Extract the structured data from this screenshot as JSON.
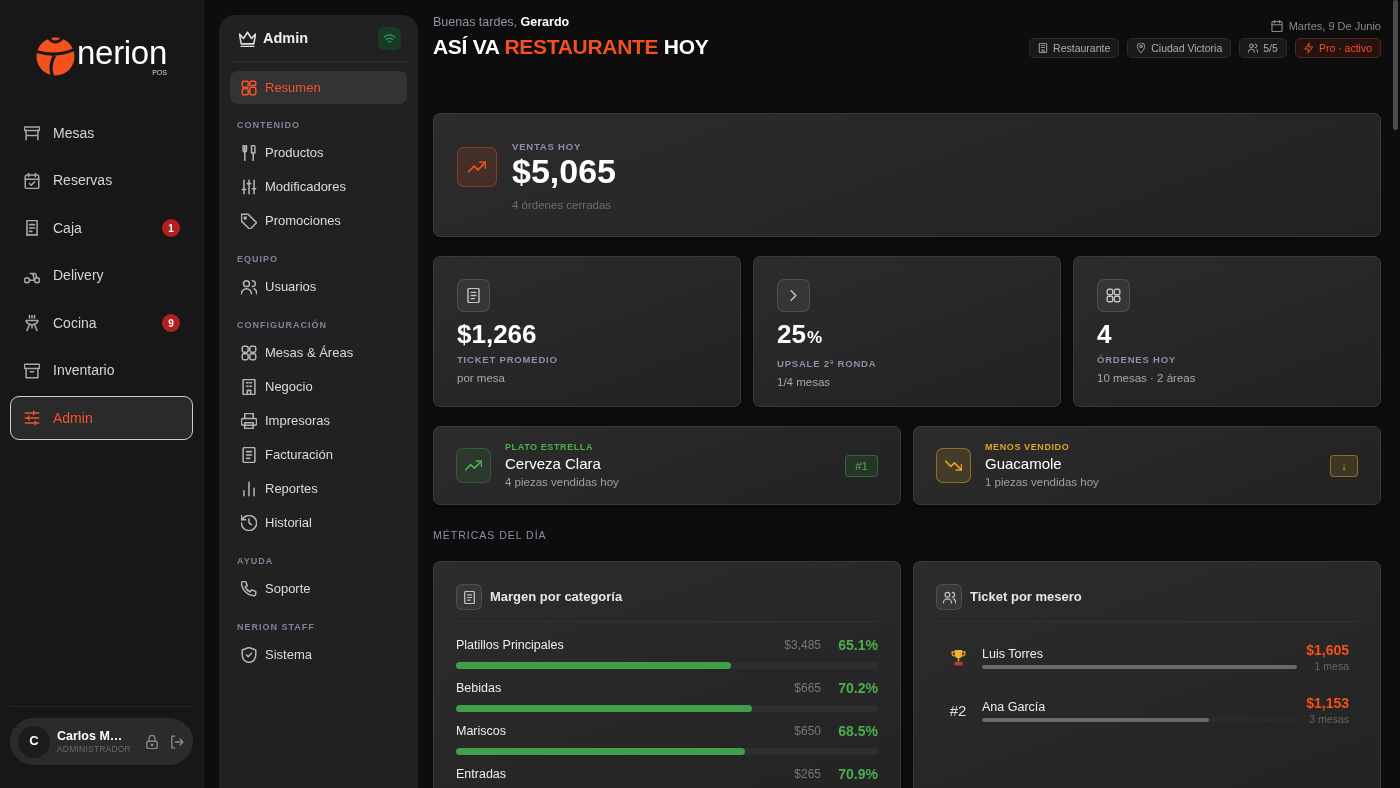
{
  "sidebar": {
    "logo": {
      "wordmark": "nerion",
      "suffix": "POS"
    },
    "items": [
      {
        "label": "Mesas",
        "selected": false
      },
      {
        "label": "Reservas",
        "selected": false
      },
      {
        "label": "Caja",
        "selected": false,
        "badge": "1"
      },
      {
        "label": "Delivery",
        "selected": false
      },
      {
        "label": "Cocina",
        "selected": false,
        "badge": "9"
      },
      {
        "label": "Inventario",
        "selected": false
      },
      {
        "label": "Admin",
        "selected": true
      }
    ],
    "user": {
      "initial": "C",
      "name": "Carlos M…",
      "role": "ADMINISTRADOR"
    }
  },
  "admin_panel": {
    "title": "Admin",
    "groups": [
      {
        "items": [
          {
            "label": "Resumen",
            "selected": true
          }
        ]
      },
      {
        "heading": "CONTENIDO",
        "items": [
          {
            "label": "Productos",
            "selected": false
          },
          {
            "label": "Modificadores",
            "selected": false
          },
          {
            "label": "Promociones",
            "selected": false
          }
        ]
      },
      {
        "heading": "EQUIPO",
        "items": [
          {
            "label": "Usuarios",
            "selected": false
          }
        ]
      },
      {
        "heading": "CONFIGURACIÓN",
        "items": [
          {
            "label": "Mesas & Áreas",
            "selected": false
          },
          {
            "label": "Negocio",
            "selected": false
          },
          {
            "label": "Impresoras",
            "selected": false
          },
          {
            "label": "Facturación",
            "selected": false
          },
          {
            "label": "Reportes",
            "selected": false
          },
          {
            "label": "Historial",
            "selected": false
          }
        ]
      },
      {
        "heading": "AYUDA",
        "items": [
          {
            "label": "Soporte",
            "selected": false
          }
        ]
      },
      {
        "heading": "NERION STAFF",
        "items": [
          {
            "label": "Sistema",
            "selected": false
          }
        ]
      }
    ]
  },
  "header": {
    "greeting": "Buenas tardes, **Gerardo**",
    "title": [
      {
        "text": "ASÍ VA ",
        "accent": false
      },
      {
        "text": "RESTAURANTE",
        "accent": true
      },
      {
        "text": " HOY",
        "accent": false
      }
    ],
    "date": "Martes, 9 De Junio",
    "chips": [
      {
        "label": "Restaurante",
        "kind": "info"
      },
      {
        "label": "Ciudad Victoria",
        "kind": "info"
      },
      {
        "label": "5/5",
        "kind": "info"
      },
      {
        "label": "Pro · activo",
        "kind": "plan"
      }
    ]
  },
  "sales": {
    "label": "VENTAS HOY",
    "value": "$5,065",
    "note": "4 órdenes cerradas"
  },
  "stats": [
    {
      "value": "$1,266",
      "label": "TICKET PROMEDIO",
      "note": "por mesa"
    },
    {
      "value": "25",
      "unit": "%",
      "label": "UPSALE 2ª RONDA",
      "note": "1/4 mesas"
    },
    {
      "value": "4",
      "label": "ÓRDENES HOY",
      "note": "10 mesas · 2 áreas"
    }
  ],
  "highlights": [
    {
      "kind": "best",
      "label": "PLATO ESTRELLA",
      "name": "Cerveza Clara",
      "note": "4 piezas vendidas hoy",
      "badge": "#1"
    },
    {
      "kind": "worst",
      "label": "MENOS VENDIDO",
      "name": "Guacamole",
      "note": "1 piezas vendidas hoy",
      "badge": "↓"
    }
  ],
  "metrics_heading": "MÉTRICAS DEL DÍA",
  "margin_panel": {
    "title": "Margen por categoría",
    "rows": [
      {
        "name": "Platillos Principales",
        "amount": "$3,485",
        "percent": "65.1%",
        "level": 0.651
      },
      {
        "name": "Bebidas",
        "amount": "$665",
        "percent": "70.2%",
        "level": 0.702
      },
      {
        "name": "Mariscos",
        "amount": "$650",
        "percent": "68.5%",
        "level": 0.685
      },
      {
        "name": "Entradas",
        "amount": "$265",
        "percent": "70.9%"
      }
    ]
  },
  "waiter_panel": {
    "title": "Ticket por mesero",
    "rows": [
      {
        "kind": "top",
        "name": "Luis Torres",
        "amount": "$1,605",
        "note": "1 mesa",
        "level": 1
      },
      {
        "kind": "ranked",
        "rank": "#2",
        "name": "Ana García",
        "amount": "$1,153",
        "note": "3 mesas",
        "level": 0.72
      }
    ]
  }
}
